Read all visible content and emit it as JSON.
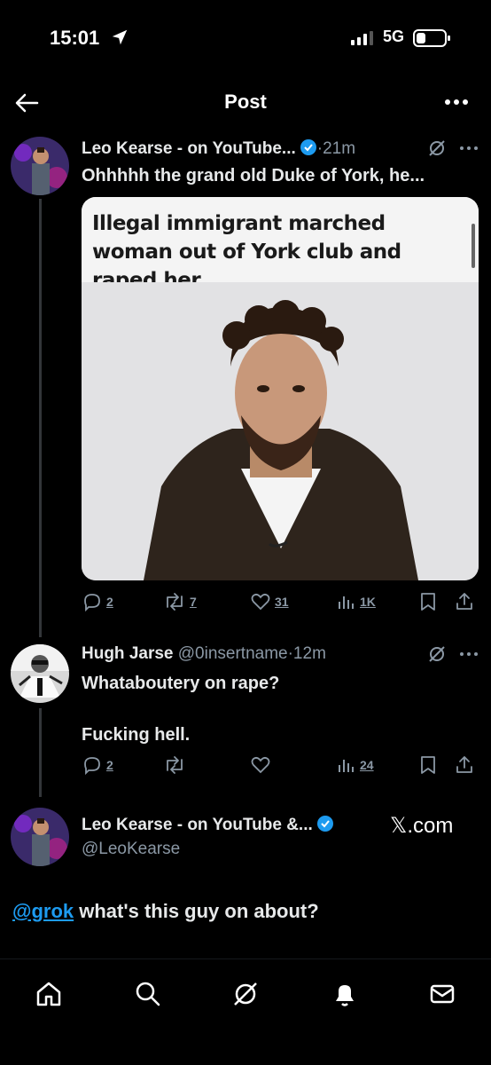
{
  "status_bar": {
    "time": "15:01",
    "network": "5G"
  },
  "header": {
    "title": "Post"
  },
  "tweet1": {
    "name": "Leo Kearse - on YouTube...",
    "time": "·21m",
    "text": "Ohhhhh the grand old Duke of York, he...",
    "media_headline": "Illegal immigrant marched woman out of York club and raped her",
    "stats": {
      "replies": "2",
      "reposts": "7",
      "likes": "31",
      "views": "1K"
    }
  },
  "tweet2": {
    "name": "Hugh Jarse",
    "handle": "@0insertname",
    "time": "·12m",
    "text_line1": "Whataboutery on rape?",
    "text_line2": "Fucking hell.",
    "stats": {
      "replies": "2",
      "reposts": "",
      "likes": "",
      "views": "24"
    }
  },
  "tweet3": {
    "name": "Leo Kearse - on YouTube &...",
    "handle": "@LeoKearse",
    "source": "𝕏.com",
    "mention": "@grok",
    "text": " what's this guy on about?"
  },
  "tabs": [
    "home-icon",
    "search-icon",
    "grok-icon",
    "notifications-icon",
    "messages-icon"
  ],
  "colors": {
    "background": "#000000",
    "accent": "#1d9bf0",
    "muted": "#8b98a5"
  }
}
